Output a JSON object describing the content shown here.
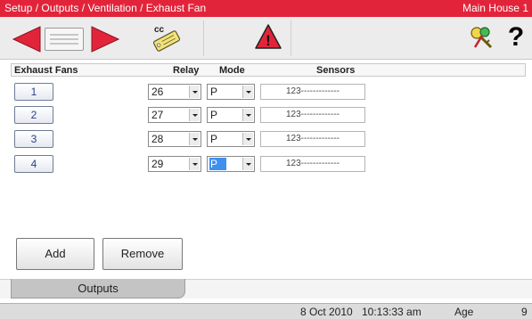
{
  "title": {
    "breadcrumb": "Setup / Outputs / Ventilation / Exhaust Fan",
    "house": "Main House 1"
  },
  "toolbar": {
    "icons": [
      "back-arrow-icon",
      "document-icon",
      "forward-arrow-icon",
      "cc-tag-icon",
      "warning-icon",
      "keys-icon",
      "help-icon"
    ],
    "cc_label": "cc",
    "warning_glyph": "!",
    "help_glyph": "?"
  },
  "table": {
    "headers": {
      "fans": "Exhaust Fans",
      "relay": "Relay",
      "mode": "Mode",
      "sensors": "Sensors"
    },
    "rows": [
      {
        "fan": "1",
        "relay": "26",
        "mode": "P",
        "sensors": "123-------------"
      },
      {
        "fan": "2",
        "relay": "27",
        "mode": "P",
        "sensors": "123-------------"
      },
      {
        "fan": "3",
        "relay": "28",
        "mode": "P",
        "sensors": "123-------------"
      },
      {
        "fan": "4",
        "relay": "29",
        "mode": "P",
        "sensors": "123-------------"
      }
    ]
  },
  "buttons": {
    "add": "Add",
    "remove": "Remove"
  },
  "tabs": {
    "outputs": "Outputs"
  },
  "status": {
    "date": "8 Oct 2010",
    "time": "10:13:33 am",
    "age_label": "Age",
    "age_value": "9"
  },
  "colors": {
    "title_bar": "#e2243a",
    "arrows": "#e2243a",
    "selection": "#3f8ff0"
  }
}
